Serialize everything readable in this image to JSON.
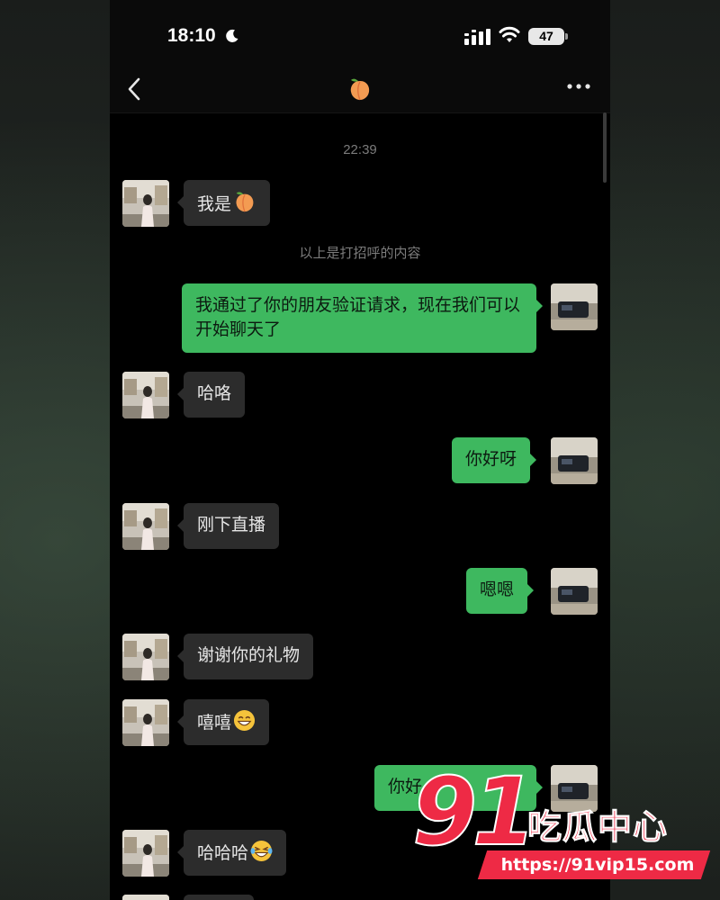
{
  "status_bar": {
    "time": "18:10",
    "battery": "47",
    "icons": [
      "moon-icon",
      "signal-icon",
      "wifi-icon",
      "battery-icon"
    ]
  },
  "nav": {
    "back_icon": "chevron-left-icon",
    "title_emoji": "peach-emoji",
    "more_icon": "more-dots-icon"
  },
  "chat": {
    "timestamp": "22:39",
    "system_note": "以上是打招呼的内容",
    "messages": [
      {
        "sender": "them",
        "text": "我是",
        "emoji": "peach-emoji"
      },
      {
        "sender": "me",
        "text": "我通过了你的朋友验证请求，现在我们可以开始聊天了"
      },
      {
        "sender": "them",
        "text": "哈咯"
      },
      {
        "sender": "me",
        "text": "你好呀"
      },
      {
        "sender": "them",
        "text": "刚下直播"
      },
      {
        "sender": "me",
        "text": "嗯嗯"
      },
      {
        "sender": "them",
        "text": "谢谢你的礼物"
      },
      {
        "sender": "them",
        "text": "嘻嘻",
        "emoji": "grinning-emoji"
      },
      {
        "sender": "me",
        "text": "你好",
        "note": "partially covered by watermark"
      },
      {
        "sender": "them",
        "text": "哈哈哈",
        "emoji": "laugh-tears-emoji"
      }
    ]
  },
  "watermark": {
    "number": "91",
    "brand": "吃瓜中心",
    "url": "https://91vip15.com"
  },
  "colors": {
    "outgoing_bubble": "#3eb85f",
    "incoming_bubble": "#2c2c2c",
    "background": "#000000",
    "watermark_red": "#ee2a45"
  }
}
